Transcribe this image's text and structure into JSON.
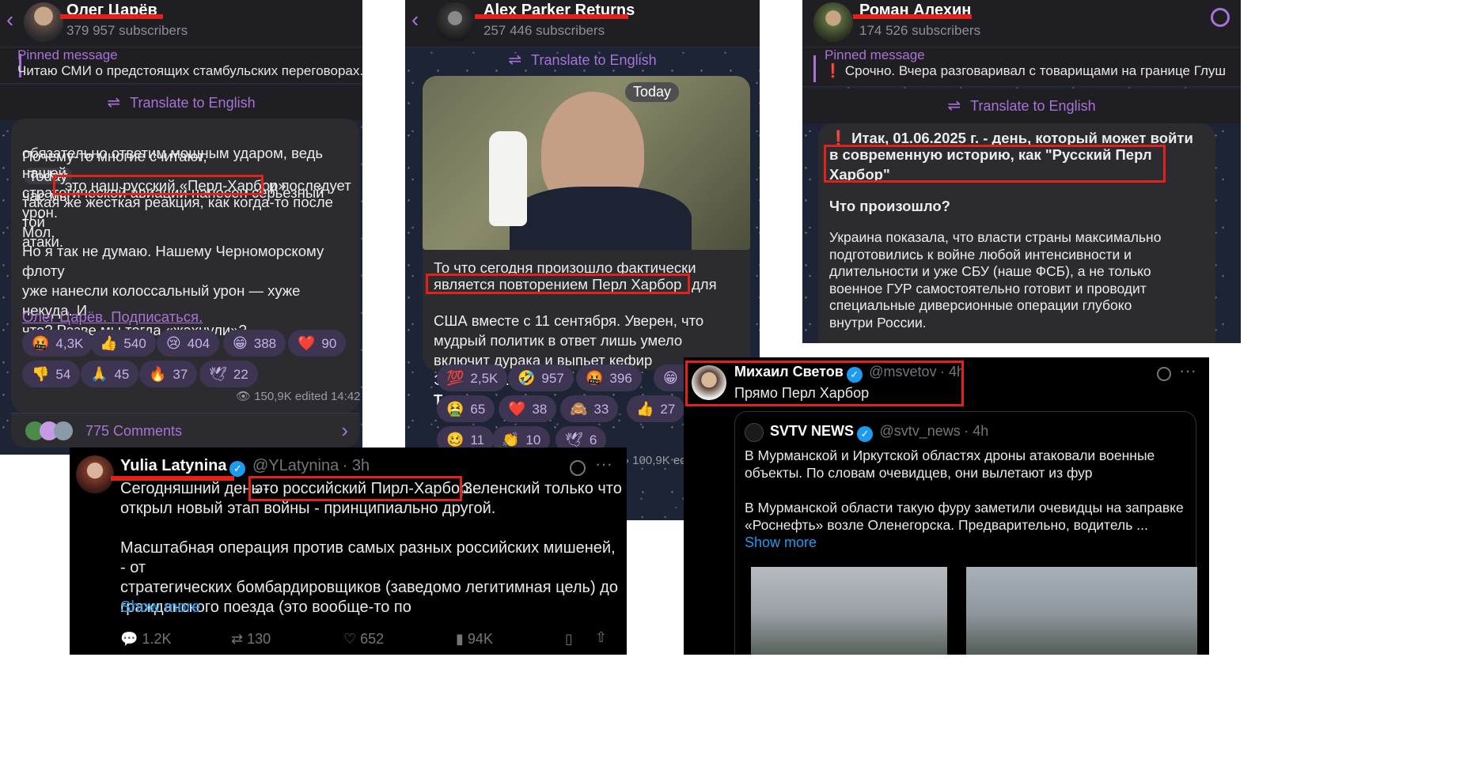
{
  "panel1": {
    "channel_name": "Олег Царёв",
    "subscribers": "379 957 subscribers",
    "pinned_title": "Pinned message",
    "pinned_text": "Читаю СМИ о предстоящих стамбульских переговорах. Сто",
    "translate_label": "Translate to English",
    "today_badge": "Today",
    "message_p1_line1": "Почему-то многие считают,",
    "message_p1_line1b": "час мы",
    "message_p1_rest": "обязательно ответим мощным ударом, ведь нашей\nстратегической авиации нанесен серьезный урон.\nМол,",
    "message_highlight": "это наш русский «Перл-Харбор»",
    "message_p1_after": "и последует",
    "message_p1_end": "такая же жесткая реакция, как когда-то после той\nатаки.",
    "message_p2": "Но я так не думаю. Нашему Черноморскому флоту\nуже нанесли колоссальный урон — хуже некуда. И\nчто? Разве мы тогда «жахнули»?",
    "signature_link": "Олег Царёв. Подписаться.",
    "reactions": [
      {
        "emoji": "🤬",
        "count": "4,3K"
      },
      {
        "emoji": "👍",
        "count": "540"
      },
      {
        "emoji": "😢",
        "count": "404"
      },
      {
        "emoji": "😁",
        "count": "388"
      },
      {
        "emoji": "❤️",
        "count": "90"
      },
      {
        "emoji": "👎",
        "count": "54"
      },
      {
        "emoji": "🙏",
        "count": "45"
      },
      {
        "emoji": "🔥",
        "count": "37"
      },
      {
        "emoji": "🕊",
        "count": "22"
      }
    ],
    "views_meta": "150,9K edited 14:42",
    "comments_label": "775 Comments"
  },
  "panel2": {
    "channel_name": "Alex Parker Returns",
    "subscribers": "257 446 subscribers",
    "translate_label": "Translate to English",
    "today_badge": "Today",
    "message_line1": "То что сегодня произошло фактически",
    "message_highlight": "является повторением Перл Харбор",
    "message_after": "для",
    "message_rest": "США вместе с 11 сентября. Уверен, что\nмудрый политик в ответ лишь умело\nвключит дурака и выпьет кефир\nЭковакино.",
    "message_bold_end": "Терпим.",
    "reactions": [
      {
        "emoji": "💯",
        "count": "2,5K"
      },
      {
        "emoji": "🤣",
        "count": "957"
      },
      {
        "emoji": "🤬",
        "count": "396"
      },
      {
        "emoji": "😁",
        "count": ""
      },
      {
        "emoji": "🤮",
        "count": "65"
      },
      {
        "emoji": "❤️",
        "count": "38"
      },
      {
        "emoji": "🙈",
        "count": "33"
      },
      {
        "emoji": "👍",
        "count": "27"
      },
      {
        "emoji": "🥴",
        "count": "11"
      },
      {
        "emoji": "👏",
        "count": "10"
      },
      {
        "emoji": "🕊",
        "count": "6"
      }
    ],
    "views_meta": "100,9K ed"
  },
  "panel3": {
    "channel_name": "Роман Алехин",
    "subscribers": "174 526 subscribers",
    "pinned_title": "Pinned message",
    "pinned_text": "❗ Срочно. Вчера разговаривал с товарищами на границе Глуш",
    "translate_label": "Translate to English",
    "message_bold_line1": "❗ Итак, 01.06.2025 г. - день, который может войти",
    "message_bold_highlight": "в современную историю, как \"Русский Перл\nХарбор\"",
    "message_subheading": "Что произошло?",
    "message_body": "Украина показала, что власти страны максимально\nподготовились к войне любой интенсивности и\nдлительности и уже СБУ (наше ФСБ), а не только\nвоенное ГУР самостоятельно готовит и проводит\nспециальные диверсионные операции глубоко\nвнутри России."
  },
  "tweet_latynina": {
    "name": "Yulia Latynina",
    "handle": "@YLatynina",
    "time": "· 3h",
    "text_start": "Сегодняшний день -",
    "text_highlight": "это российский Пирл-Харбор.",
    "text_after": "Зеленский только что",
    "text_line2": "открыл новый этап войны - принципиально другой.",
    "text_para2": "Масштабная операция против самых разных российских мишеней, - от\nстратегических бомбардировщиков (заведомо легитимная цель) до\nгражданского поезда (это вообще-то по",
    "show_more": "Show more",
    "replies": "1.2K",
    "reposts": "130",
    "likes": "652",
    "views": "94K"
  },
  "tweet_svetov": {
    "name": "Михаил Светов",
    "handle": "@msvetov",
    "time": "· 4h",
    "text": "Прямо Перл Харбор",
    "quoted": {
      "name": "SVTV NEWS",
      "handle": "@svtv_news",
      "time": "· 4h",
      "text_p1": "В Мурманской и Иркутской областях дроны атаковали военные\nобъекты. По словам очевидцев, они вылетают из фур",
      "text_p2": "В Мурманской области такую фуру заметили очевидцы на заправке\n«Роснефть» возле Оленегорска. Предварительно, водитель ...",
      "show_more": "Show more"
    }
  }
}
